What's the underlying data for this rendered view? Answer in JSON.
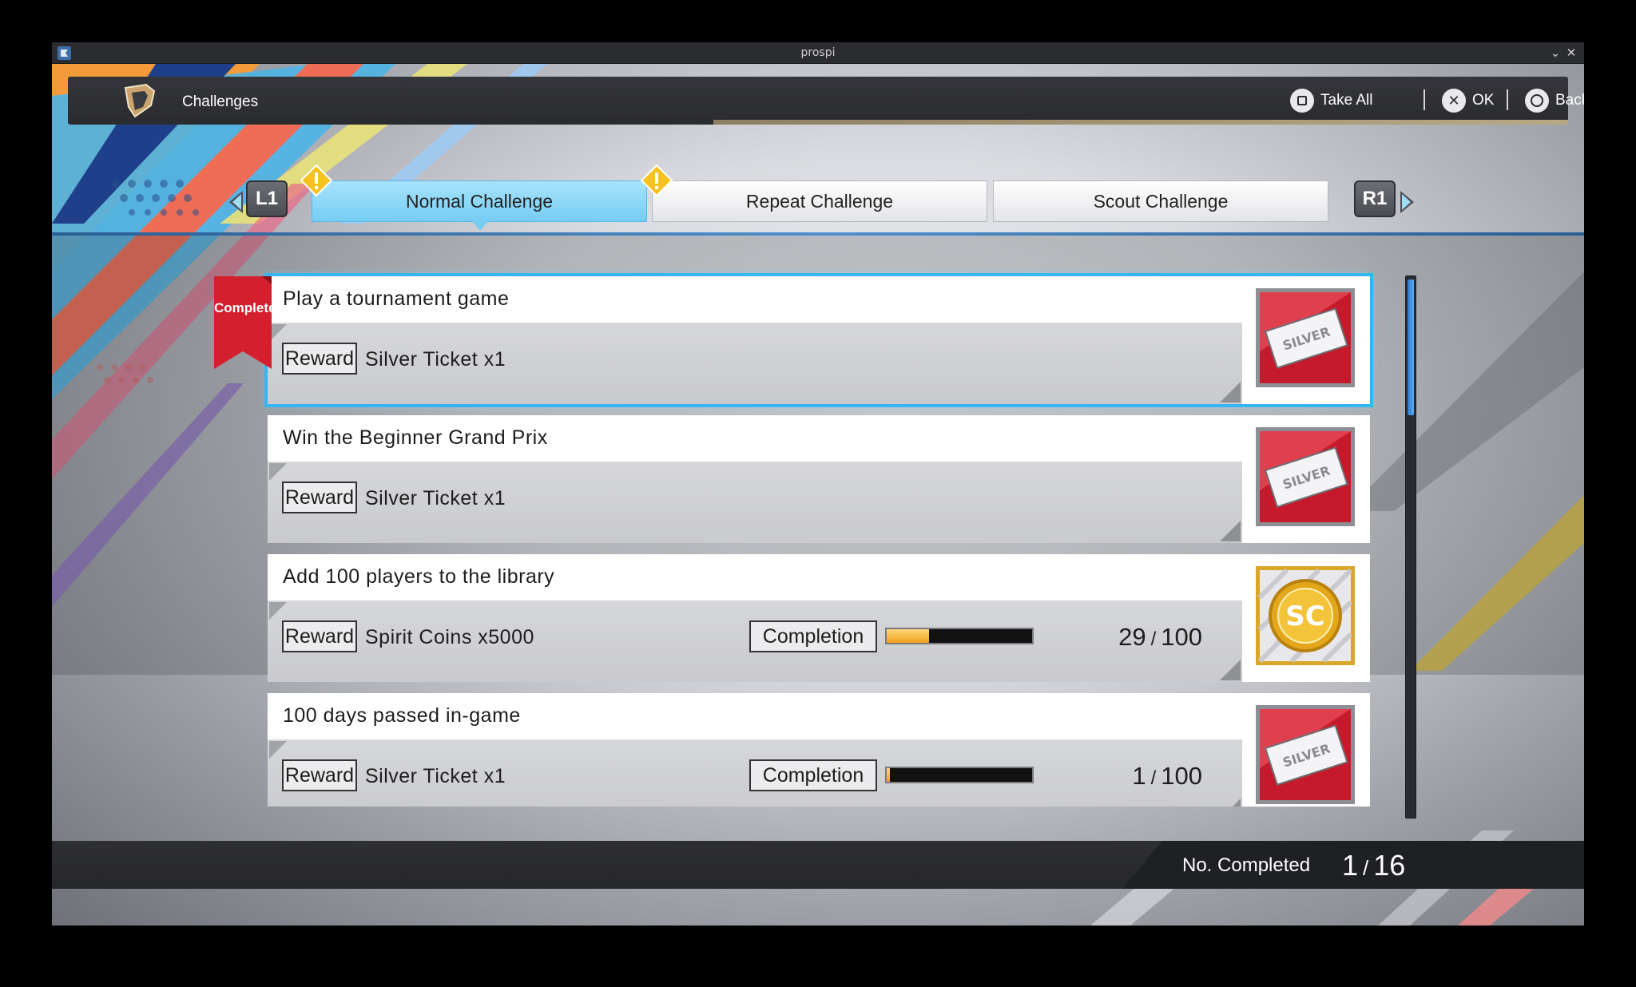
{
  "window": {
    "title": "prospi"
  },
  "header": {
    "title": "Challenges",
    "actions": [
      {
        "key": "square",
        "label": "Take All"
      },
      {
        "key": "cross",
        "label": "OK"
      },
      {
        "key": "circle",
        "label": "Back"
      }
    ]
  },
  "tabs": {
    "left_shoulder": "L1",
    "right_shoulder": "R1",
    "items": [
      {
        "label": "Normal Challenge",
        "active": true,
        "alert": true
      },
      {
        "label": "Repeat Challenge",
        "active": false,
        "alert": true
      },
      {
        "label": "Scout Challenge",
        "active": false,
        "alert": false
      }
    ]
  },
  "challenges": [
    {
      "title": "Play a tournament game",
      "reward_label": "Reward",
      "reward": "Silver Ticket x1",
      "reward_icon": "silver-ticket-icon",
      "complete": true,
      "complete_label": "Complete",
      "selected": true
    },
    {
      "title": "Win the Beginner Grand Prix",
      "reward_label": "Reward",
      "reward": "Silver Ticket x1",
      "reward_icon": "silver-ticket-icon",
      "complete": false
    },
    {
      "title": "Add 100 players to the library",
      "reward_label": "Reward",
      "reward": "Spirit Coins x5000",
      "reward_icon": "spirit-coin-icon",
      "complete": false,
      "completion_label": "Completion",
      "progress": 29,
      "total": 100
    },
    {
      "title": "100 days passed in-game",
      "reward_label": "Reward",
      "reward": "Silver Ticket x1",
      "reward_icon": "silver-ticket-icon",
      "complete": false,
      "completion_label": "Completion",
      "progress": 1,
      "total": 100
    }
  ],
  "footer": {
    "label": "No. Completed",
    "completed": 1,
    "total": 16
  },
  "colors": {
    "accent_blue": "#36b5f0",
    "tab_active": "#76cdf3",
    "ribbon_red": "#d4202e",
    "progress_fill": "#f2a21c",
    "alert_yellow": "#f6c21f"
  }
}
